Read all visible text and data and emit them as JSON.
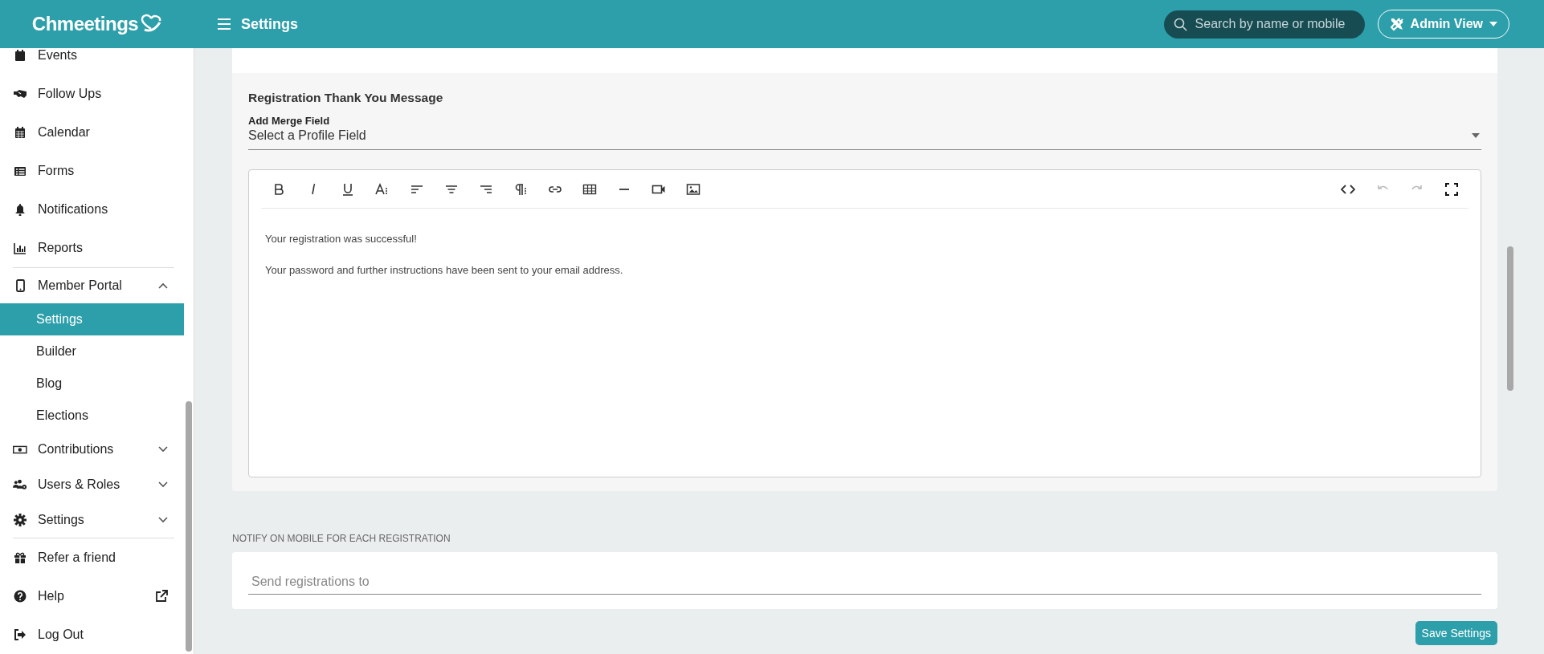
{
  "topbar": {
    "logo": "Chmeetings",
    "page_title": "Settings",
    "search": {
      "placeholder": "Search by name or mobile"
    },
    "view_button": "Admin View"
  },
  "sidebar": {
    "sections": [
      {
        "items": [
          {
            "label": "Events"
          },
          {
            "label": "Follow Ups"
          },
          {
            "label": "Calendar"
          },
          {
            "label": "Forms"
          },
          {
            "label": "Notifications"
          },
          {
            "label": "Reports"
          }
        ]
      },
      {
        "items": [
          {
            "label": "Member Portal",
            "expanded": true,
            "children": [
              {
                "label": "Settings",
                "selected": true
              },
              {
                "label": "Builder",
                "selected": false
              },
              {
                "label": "Blog",
                "selected": false
              },
              {
                "label": "Elections",
                "selected": false
              }
            ]
          },
          {
            "label": "Contributions",
            "expanded": false
          },
          {
            "label": "Users & Roles",
            "expanded": false
          },
          {
            "label": "Settings",
            "expanded": false
          }
        ]
      },
      {
        "items": [
          {
            "label": "Refer a friend",
            "external": false
          },
          {
            "label": "Help",
            "external": true
          },
          {
            "label": "Log Out",
            "external": false
          }
        ]
      }
    ]
  },
  "message_section": {
    "title": "Registration Thank You Message",
    "merge_field": {
      "label": "Add Merge Field",
      "value": "Select a Profile Field"
    },
    "editor": {
      "undo": {
        "disabled": true
      },
      "redo": {
        "disabled": true
      },
      "paragraphs": [
        "Your registration was successful!",
        "Your password and further instructions have been sent to your email address."
      ]
    }
  },
  "notify_section": {
    "label": "NOTIFY ON MOBILE FOR EACH REGISTRATION",
    "field": {
      "placeholder": "Send registrations to"
    }
  },
  "save_button": "Save Settings"
}
